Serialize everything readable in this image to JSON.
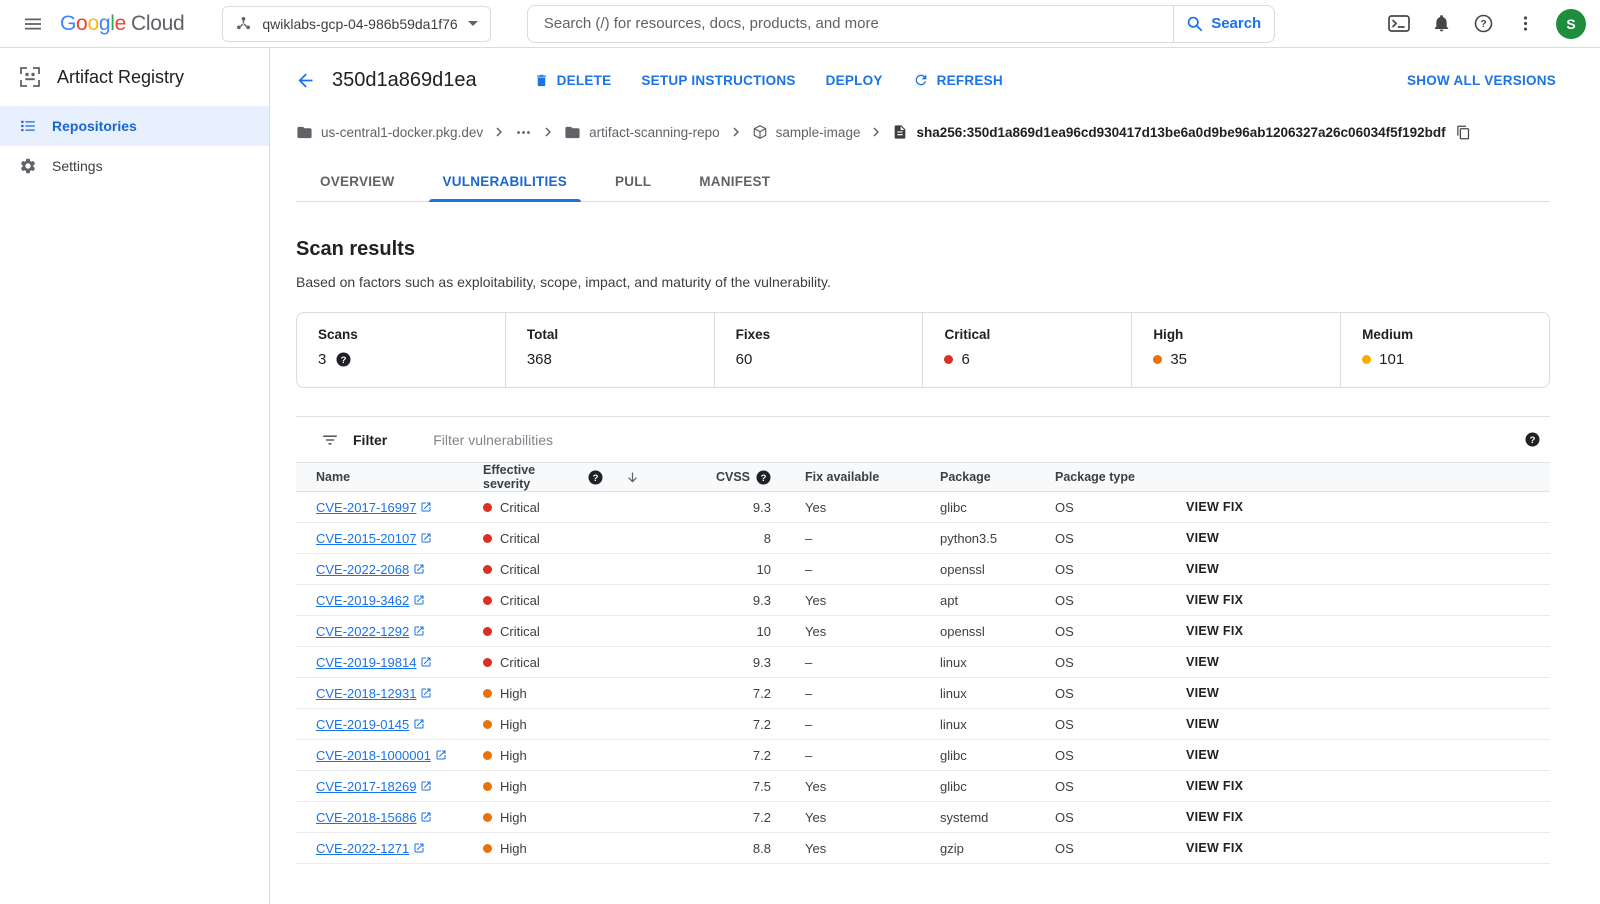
{
  "topbar": {
    "logo": {
      "letters": [
        {
          "ch": "G",
          "color": "#4285F4"
        },
        {
          "ch": "o",
          "color": "#EA4335"
        },
        {
          "ch": "o",
          "color": "#FBBC04"
        },
        {
          "ch": "g",
          "color": "#4285F4"
        },
        {
          "ch": "l",
          "color": "#34A853"
        },
        {
          "ch": "e",
          "color": "#EA4335"
        }
      ],
      "suffix": "Cloud"
    },
    "project_name": "qwiklabs-gcp-04-986b59da1f76",
    "search_placeholder": "Search (/) for resources, docs, products, and more",
    "search_button_label": "Search",
    "avatar_letter": "S",
    "avatar_color": "#1e8e3e"
  },
  "sidebar": {
    "product_name": "Artifact Registry",
    "items": [
      {
        "label": "Repositories",
        "icon": "list",
        "selected": true
      },
      {
        "label": "Settings",
        "icon": "gear",
        "selected": false
      }
    ]
  },
  "detail_header": {
    "title": "350d1a869d1ea",
    "actions": [
      {
        "label": "DELETE",
        "icon": "delete"
      },
      {
        "label": "SETUP INSTRUCTIONS"
      },
      {
        "label": "DEPLOY"
      },
      {
        "label": "REFRESH",
        "icon": "refresh"
      }
    ],
    "show_all_versions_label": "SHOW ALL VERSIONS"
  },
  "breadcrumb": [
    {
      "label": "us-central1-docker.pkg.dev",
      "icon": "folder"
    },
    {
      "label": "",
      "icon": "more-horiz"
    },
    {
      "label": "artifact-scanning-repo",
      "icon": "folder"
    },
    {
      "label": "sample-image",
      "icon": "package"
    },
    {
      "label": "sha256:350d1a869d1ea96cd930417d13be6a0d9be96ab1206327a26c06034f5f192bdf",
      "icon": "document",
      "copy": true
    }
  ],
  "tabs": [
    {
      "label": "OVERVIEW",
      "active": false
    },
    {
      "label": "VULNERABILITIES",
      "active": true
    },
    {
      "label": "PULL",
      "active": false
    },
    {
      "label": "MANIFEST",
      "active": false
    }
  ],
  "scan_results": {
    "title": "Scan results",
    "subtitle": "Based on factors such as exploitability, scope, impact, and maturity of the vulnerability.",
    "stats": [
      {
        "label": "Scans",
        "value": "3",
        "help": true
      },
      {
        "label": "Total",
        "value": "368"
      },
      {
        "label": "Fixes",
        "value": "60"
      },
      {
        "label": "Critical",
        "value": "6",
        "dot": "#d93025"
      },
      {
        "label": "High",
        "value": "35",
        "dot": "#e8710a"
      },
      {
        "label": "Medium",
        "value": "101",
        "dot": "#f9ab00"
      }
    ]
  },
  "filter_bar": {
    "label": "Filter",
    "placeholder": "Filter vulnerabilities"
  },
  "vuln_table": {
    "columns": {
      "name": "Name",
      "severity": "Effective severity",
      "cvss": "CVSS",
      "fix": "Fix available",
      "package": "Package",
      "package_type": "Package type"
    },
    "severity_colors": {
      "Critical": "#d93025",
      "High": "#e8710a",
      "Medium": "#f9ab00"
    },
    "rows": [
      {
        "name": "CVE-2017-16997",
        "severity": "Critical",
        "cvss": "9.3",
        "fix": "Yes",
        "package": "glibc",
        "package_type": "OS",
        "action": "VIEW FIX"
      },
      {
        "name": "CVE-2015-20107",
        "severity": "Critical",
        "cvss": "8",
        "fix": "–",
        "package": "python3.5",
        "package_type": "OS",
        "action": "VIEW"
      },
      {
        "name": "CVE-2022-2068",
        "severity": "Critical",
        "cvss": "10",
        "fix": "–",
        "package": "openssl",
        "package_type": "OS",
        "action": "VIEW"
      },
      {
        "name": "CVE-2019-3462",
        "severity": "Critical",
        "cvss": "9.3",
        "fix": "Yes",
        "package": "apt",
        "package_type": "OS",
        "action": "VIEW FIX"
      },
      {
        "name": "CVE-2022-1292",
        "severity": "Critical",
        "cvss": "10",
        "fix": "Yes",
        "package": "openssl",
        "package_type": "OS",
        "action": "VIEW FIX"
      },
      {
        "name": "CVE-2019-19814",
        "severity": "Critical",
        "cvss": "9.3",
        "fix": "–",
        "package": "linux",
        "package_type": "OS",
        "action": "VIEW"
      },
      {
        "name": "CVE-2018-12931",
        "severity": "High",
        "cvss": "7.2",
        "fix": "–",
        "package": "linux",
        "package_type": "OS",
        "action": "VIEW"
      },
      {
        "name": "CVE-2019-0145",
        "severity": "High",
        "cvss": "7.2",
        "fix": "–",
        "package": "linux",
        "package_type": "OS",
        "action": "VIEW"
      },
      {
        "name": "CVE-2018-1000001",
        "severity": "High",
        "cvss": "7.2",
        "fix": "–",
        "package": "glibc",
        "package_type": "OS",
        "action": "VIEW"
      },
      {
        "name": "CVE-2017-18269",
        "severity": "High",
        "cvss": "7.5",
        "fix": "Yes",
        "package": "glibc",
        "package_type": "OS",
        "action": "VIEW FIX"
      },
      {
        "name": "CVE-2018-15686",
        "severity": "High",
        "cvss": "7.2",
        "fix": "Yes",
        "package": "systemd",
        "package_type": "OS",
        "action": "VIEW FIX"
      },
      {
        "name": "CVE-2022-1271",
        "severity": "High",
        "cvss": "8.8",
        "fix": "Yes",
        "package": "gzip",
        "package_type": "OS",
        "action": "VIEW FIX"
      }
    ]
  }
}
